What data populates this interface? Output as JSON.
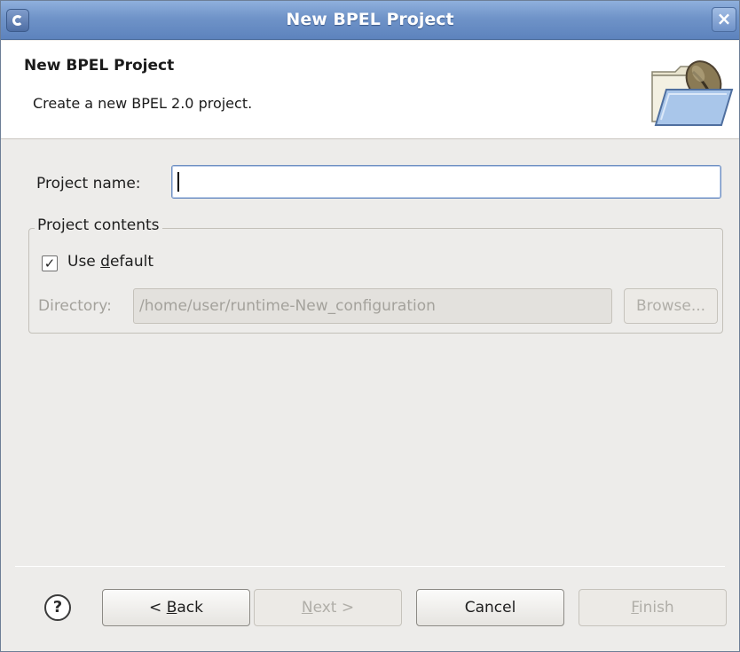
{
  "window": {
    "title": "New BPEL Project",
    "close_glyph": "×"
  },
  "banner": {
    "title": "New BPEL Project",
    "description": "Create a new BPEL 2.0 project.",
    "icon": "open-folder-icon"
  },
  "project_name": {
    "label": "Project name:",
    "value": ""
  },
  "contents": {
    "legend": "Project contents",
    "use_default": {
      "label_pre": "Use ",
      "label_mnemonic": "d",
      "label_post": "efault",
      "checked": true,
      "check_glyph": "✓"
    },
    "directory": {
      "label": "Directory:",
      "value": "/home/user/runtime-New_configuration"
    },
    "browse_label": "Browse..."
  },
  "footer": {
    "help_glyph": "?",
    "back": {
      "pre": "< ",
      "mnemonic": "B",
      "post": "ack"
    },
    "next": {
      "pre": "",
      "mnemonic": "N",
      "post": "ext >"
    },
    "cancel": "Cancel",
    "finish": {
      "pre": "",
      "mnemonic": "F",
      "post": "inish"
    }
  }
}
